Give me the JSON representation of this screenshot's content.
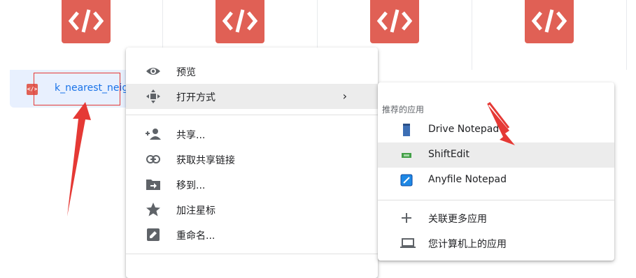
{
  "file_grid": {
    "tiles": [
      {
        "icon": "code-file-icon"
      },
      {
        "icon": "code-file-icon"
      },
      {
        "icon": "code-file-icon"
      },
      {
        "icon": "code-file-icon"
      }
    ],
    "selected_file": {
      "name": "k_nearest_neigh",
      "icon": "code-file-icon"
    }
  },
  "context_menu": {
    "items": [
      {
        "label": "预览",
        "icon": "eye-icon"
      },
      {
        "label": "打开方式",
        "icon": "move-arrows-icon",
        "submenu_arrow": "›"
      },
      {
        "label": "共享...",
        "icon": "add-person-icon"
      },
      {
        "label": "获取共享链接",
        "icon": "link-icon"
      },
      {
        "label": "移到...",
        "icon": "folder-move-icon"
      },
      {
        "label": "加注星标",
        "icon": "star-icon"
      },
      {
        "label": "重命名...",
        "icon": "edit-icon"
      }
    ]
  },
  "open_with_submenu": {
    "header": "推荐的应用",
    "apps": [
      {
        "label": "Drive Notepad",
        "icon": "notepad-icon",
        "color": "#3c6eb4"
      },
      {
        "label": "ShiftEdit",
        "icon": "shiftedit-icon",
        "color": "#43a047"
      },
      {
        "label": "Anyfile Notepad",
        "icon": "anyfile-icon",
        "color": "#1e88e5"
      }
    ],
    "actions": [
      {
        "label": "关联更多应用",
        "icon": "plus-icon"
      },
      {
        "label": "您计算机上的应用",
        "icon": "laptop-icon"
      }
    ]
  },
  "colors": {
    "accent_red": "#e06055",
    "annotation_red": "#e53935",
    "link_blue": "#1a73e8"
  }
}
